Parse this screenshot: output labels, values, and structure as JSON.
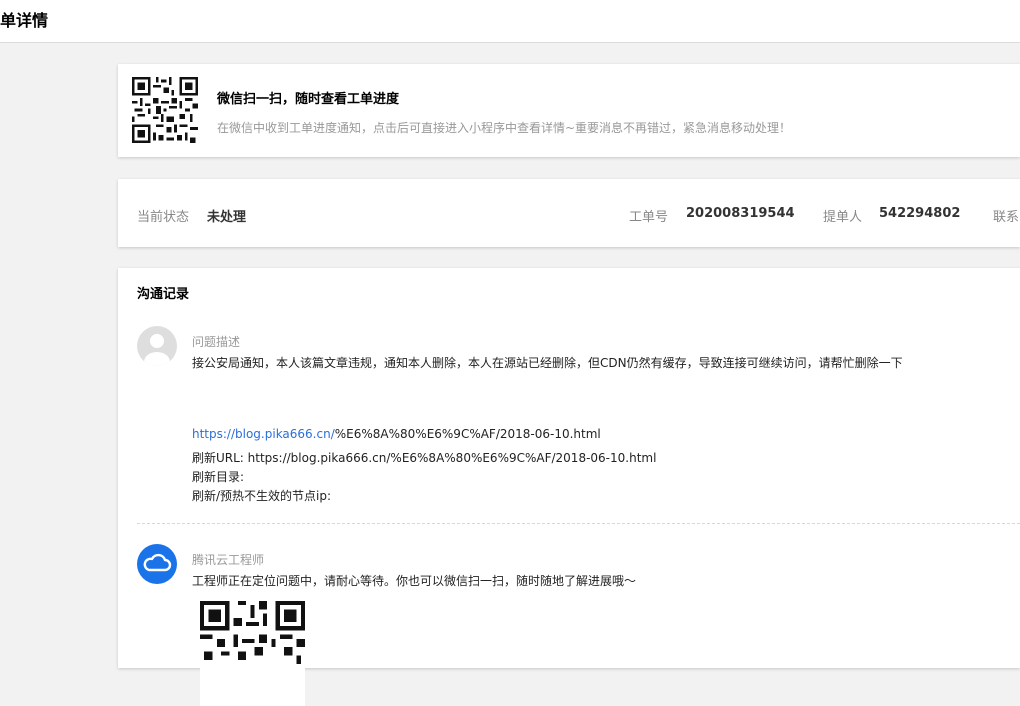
{
  "header": {
    "title": "单详情"
  },
  "qr_banner": {
    "title": "微信扫一扫，随时查看工单进度",
    "description": "在微信中收到工单进度通知，点击后可直接进入小程序中查看详情~重要消息不再错过，紧急消息移动处理！"
  },
  "status": {
    "state_label": "当前状态",
    "state_value": "未处理",
    "ticket_label": "工单号",
    "ticket_value": "202008319544",
    "submitter_label": "提单人",
    "submitter_value": "542294802",
    "contact_label": "联系"
  },
  "communication": {
    "title": "沟通记录",
    "records": [
      {
        "author": "问题描述",
        "text": "接公安局通知，本人该篇文章违规，通知本人删除，本人在源站已经删除，但CDN仍然有缓存，导致连接可继续访问，请帮忙删除一下",
        "link_part": "https://blog.pika666.cn/",
        "link_rest": "%E6%8A%80%E6%9C%AF/2018-06-10.html",
        "refresh_url": "刷新URL: https://blog.pika666.cn/%E6%8A%80%E6%9C%AF/2018-06-10.html",
        "refresh_dir": "刷新目录:",
        "refresh_ip": "刷新/预热不生效的节点ip:"
      },
      {
        "author": "腾讯云工程师",
        "text": "工程师正在定位问题中，请耐心等待。你也可以微信扫一扫，随时随地了解进展哦～"
      }
    ]
  },
  "icons": {
    "qr": "qr-code-icon",
    "user_avatar": "user-avatar-icon",
    "engineer_avatar": "tencent-cloud-icon"
  },
  "colors": {
    "link": "#2a6fdb",
    "engineer_avatar": "#1a73e8",
    "muted_text": "#999999"
  }
}
